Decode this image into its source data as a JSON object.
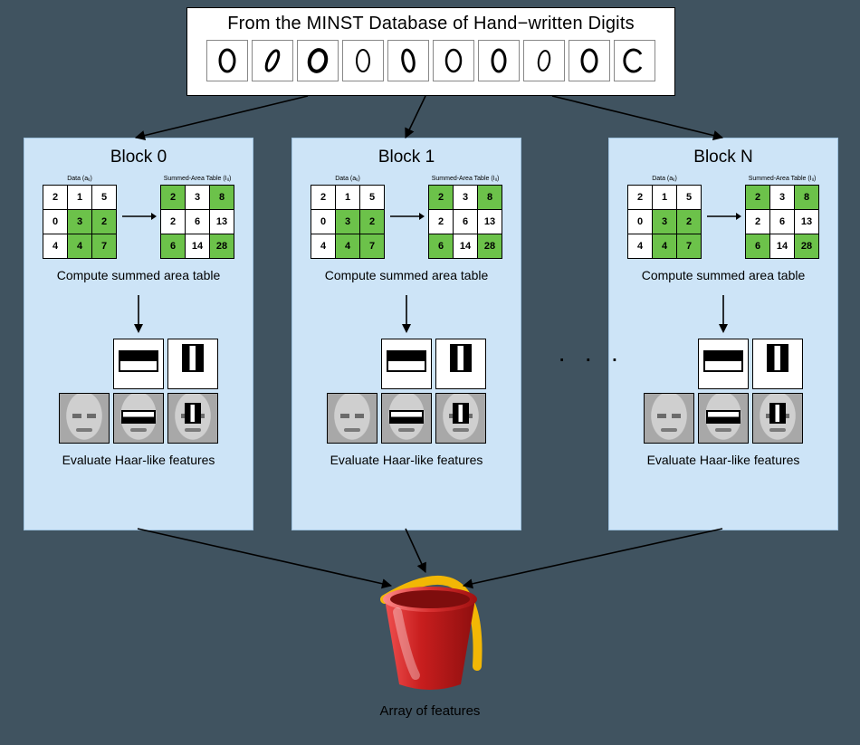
{
  "header": {
    "title": "From the MINST Database of Hand−written Digits",
    "digit_count": 10
  },
  "blocks": [
    {
      "title": "Block 0",
      "compute_label": "Compute summed area table",
      "eval_label": "Evaluate Haar-like features"
    },
    {
      "title": "Block 1",
      "compute_label": "Compute summed area table",
      "eval_label": "Evaluate Haar-like features"
    },
    {
      "title": "Block N",
      "compute_label": "Compute summed area table",
      "eval_label": "Evaluate Haar-like features"
    }
  ],
  "ellipsis": "· · ·",
  "sat": {
    "left_caption": "Data (aᵢⱼ)",
    "right_caption": "Summed-Area Table (Iᵢⱼ)",
    "data": [
      [
        2,
        1,
        5
      ],
      [
        0,
        3,
        2
      ],
      [
        4,
        4,
        7
      ]
    ],
    "data_green": [
      [
        0,
        0,
        0
      ],
      [
        0,
        1,
        1
      ],
      [
        0,
        1,
        1
      ]
    ],
    "summed": [
      [
        2,
        3,
        8
      ],
      [
        2,
        6,
        13
      ],
      [
        6,
        14,
        28
      ]
    ],
    "summed_green": [
      [
        1,
        0,
        1
      ],
      [
        0,
        0,
        0
      ],
      [
        1,
        0,
        1
      ]
    ]
  },
  "output_label": "Array of features",
  "icons": {
    "bucket": "bucket-icon"
  }
}
